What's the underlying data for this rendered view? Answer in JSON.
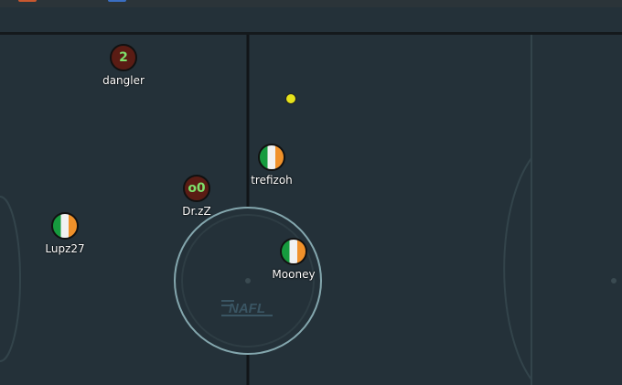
{
  "game": {
    "logo_text": "NAFL",
    "players": [
      {
        "name": "dangler",
        "avatar": "2",
        "team": "red"
      },
      {
        "name": "Dr.zZ",
        "avatar": "o0",
        "team": "red"
      },
      {
        "name": "trefizoh",
        "avatar": "",
        "team": "flag"
      },
      {
        "name": "Lupz27",
        "avatar": "",
        "team": "flag"
      },
      {
        "name": "Mooney",
        "avatar": "",
        "team": "flag"
      }
    ],
    "colors": {
      "field": "#243139",
      "lines": "#3b4d54",
      "center_circle": "#84a7ae",
      "red_team": "#5a1c14",
      "ball": "#e6e21b"
    }
  }
}
